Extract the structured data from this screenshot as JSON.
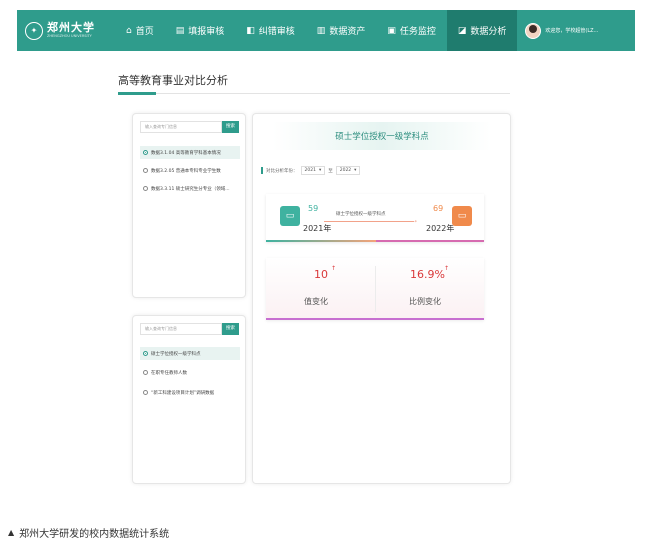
{
  "brand": {
    "name": "郑州大学",
    "subtitle": "ZHENGZHOU UNIVERSITY"
  },
  "nav": [
    {
      "icon": "home-icon",
      "glyph": "⌂",
      "label": "首页",
      "active": false
    },
    {
      "icon": "form-icon",
      "glyph": "▤",
      "label": "填报审核",
      "active": false
    },
    {
      "icon": "check-icon",
      "glyph": "◧",
      "label": "纠错审核",
      "active": false
    },
    {
      "icon": "doc-icon",
      "glyph": "▥",
      "label": "数据资产",
      "active": false
    },
    {
      "icon": "task-icon",
      "glyph": "▣",
      "label": "任务监控",
      "active": false
    },
    {
      "icon": "chart-icon",
      "glyph": "◪",
      "label": "数据分析",
      "active": true
    }
  ],
  "user": {
    "name": "欢迎您，学校超管(LZ..."
  },
  "page": {
    "title": "高等教育事业对比分析"
  },
  "panel1": {
    "search_placeholder": "输入查询专门信息",
    "search_button": "搜索",
    "options": [
      {
        "label": "数据3.1.04 高等教育学科基本情况",
        "selected": true
      },
      {
        "label": "数据3.2.05 普通本专科专业学生数",
        "selected": false
      },
      {
        "label": "数据3.3.11 硕士研究生分专业（领域...",
        "selected": false
      }
    ]
  },
  "panel2": {
    "search_placeholder": "输入查询专门信息",
    "search_button": "搜索",
    "options": [
      {
        "label": "硕士学位授权一级学科点",
        "selected": true
      },
      {
        "label": "在职专任教师人数",
        "selected": false
      },
      {
        "label": "“新工科建设项目计划”调研数据",
        "selected": false
      }
    ]
  },
  "main": {
    "hero_title": "硕士学位授权一级学科点",
    "filter_label": "对比分析年份：",
    "year_from": "2021",
    "year_sep": "至",
    "year_to": "2022",
    "left": {
      "value": "59",
      "year": "2021年"
    },
    "right": {
      "value": "69",
      "year": "2022年"
    },
    "mid_label": "硕士学位授权一级学科点",
    "change_value": "10",
    "change_value_label": "值变化",
    "change_ratio": "16.9%",
    "change_ratio_label": "比例变化"
  },
  "caption": {
    "marker": "▲",
    "text": "郑州大学研发的校内数据统计系统"
  },
  "colors": {
    "nav": "#2f9c8c",
    "nav_active": "#1f7c6e",
    "accent": "#2f9c8c",
    "up": "#d9383a",
    "left_icon": "#3fb2a0",
    "right_icon": "#f08a4b"
  }
}
